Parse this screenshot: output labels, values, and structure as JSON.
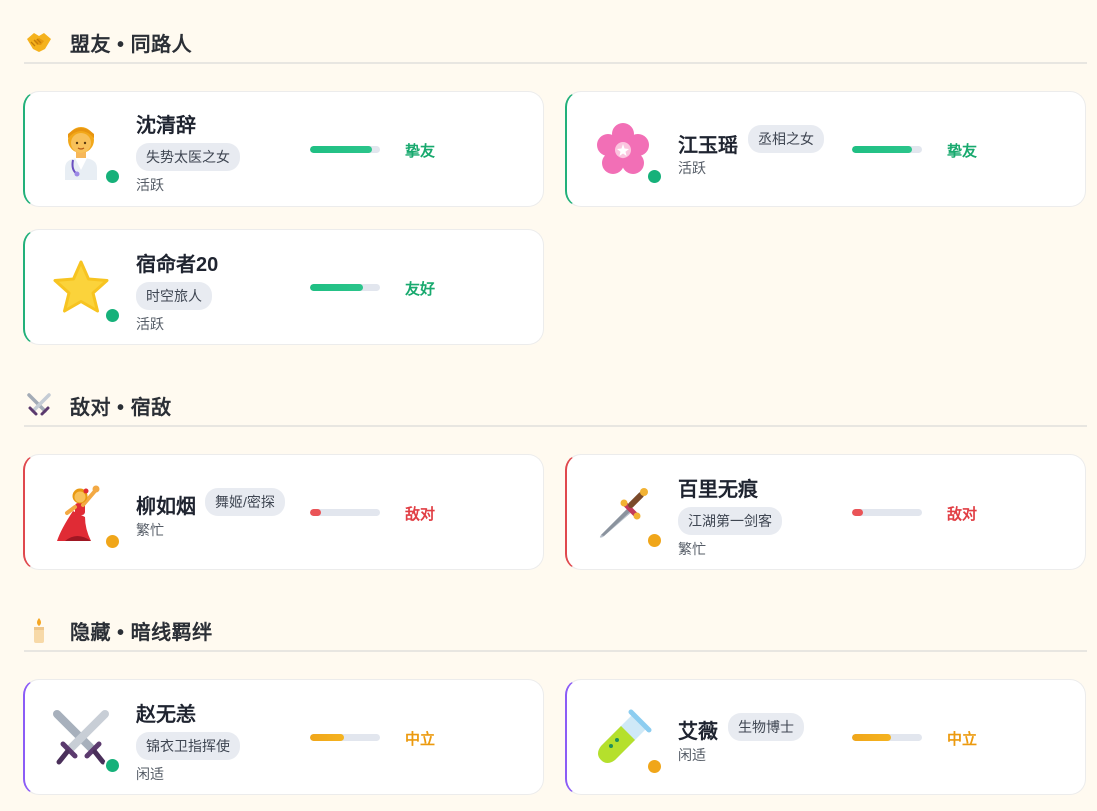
{
  "sections": [
    {
      "title": "盟友 • 同路人",
      "icon": "handshake-icon"
    },
    {
      "title": "敌对 • 宿敌",
      "icon": "crossed-swords-icon"
    },
    {
      "title": "隐藏 • 暗线羁绊",
      "icon": "candle-icon"
    }
  ],
  "cards": [
    {
      "name": "沈清辞",
      "role": "失势太医之女",
      "status": "活跃",
      "relation": "挚友",
      "affinity": 0.88,
      "avatar": "woman-doctor-icon"
    },
    {
      "name": "江玉瑶",
      "role": "丞相之女",
      "status": "活跃",
      "relation": "挚友",
      "affinity": 0.85,
      "avatar": "cherry-blossom-icon"
    },
    {
      "name": "宿命者20",
      "role": "时空旅人",
      "status": "活跃",
      "relation": "友好",
      "affinity": 0.75,
      "avatar": "star-icon"
    },
    {
      "name": "柳如烟",
      "role": "舞姬/密探",
      "status": "繁忙",
      "relation": "敌对",
      "affinity": 0.15,
      "avatar": "dancer-icon"
    },
    {
      "name": "百里无痕",
      "role": "江湖第一剑客",
      "status": "繁忙",
      "relation": "敌对",
      "affinity": 0.15,
      "avatar": "dagger-icon"
    },
    {
      "name": "赵无恙",
      "role": "锦衣卫指挥使",
      "status": "闲适",
      "relation": "中立",
      "affinity": 0.48,
      "avatar": "crossed-swords-icon"
    },
    {
      "name": "艾薇",
      "role": "生物博士",
      "status": "闲适",
      "relation": "中立",
      "affinity": 0.55,
      "avatar": "test-tube-icon"
    }
  ],
  "colors": {
    "friend": "#22b07a",
    "enemy": "#e0484d",
    "neutral": "#f0a61a",
    "hidden_border": "#8b5cf6"
  }
}
